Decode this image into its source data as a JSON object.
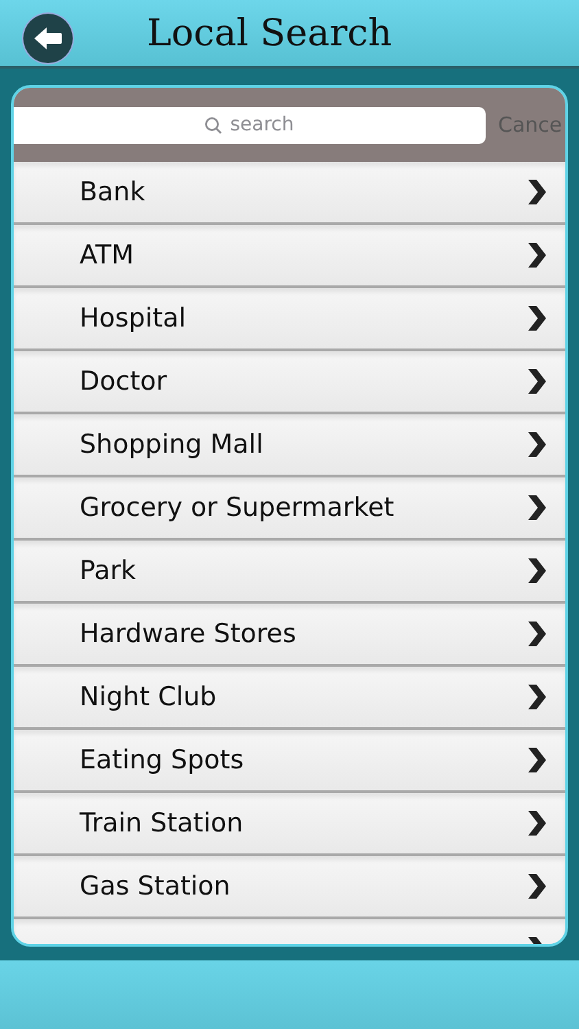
{
  "header": {
    "title": "Local Search"
  },
  "search": {
    "placeholder": "search",
    "cancel": "Cance"
  },
  "categories": [
    {
      "label": "Bank"
    },
    {
      "label": "ATM"
    },
    {
      "label": "Hospital"
    },
    {
      "label": "Doctor"
    },
    {
      "label": "Shopping Mall"
    },
    {
      "label": "Grocery or Supermarket"
    },
    {
      "label": "Park"
    },
    {
      "label": "Hardware Stores"
    },
    {
      "label": "Night Club"
    },
    {
      "label": "Eating Spots"
    },
    {
      "label": "Train Station"
    },
    {
      "label": "Gas Station"
    }
  ]
}
